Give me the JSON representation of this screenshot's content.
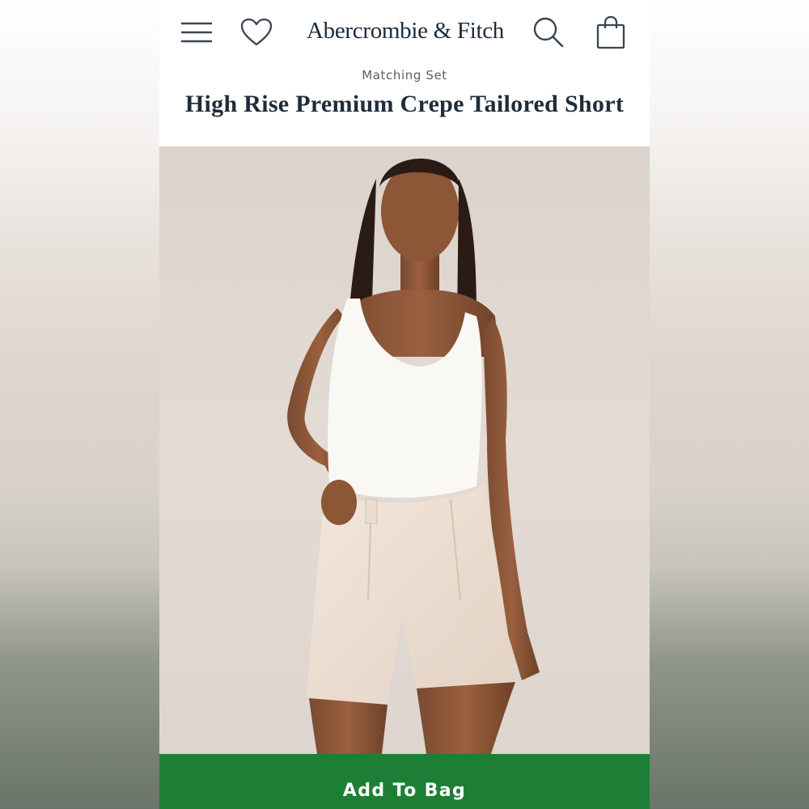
{
  "header": {
    "brand": "Abercrombie & Fitch",
    "icons": {
      "menu": "hamburger-menu-icon",
      "wishlist": "heart-icon",
      "search": "search-icon",
      "bag": "shopping-bag-icon"
    }
  },
  "product": {
    "eyebrow": "Matching Set",
    "title": "High Rise Premium Crepe Tailored Short",
    "image_description": "model in white tank top and cream pleated shorts"
  },
  "actions": {
    "add_to_bag": "Add To Bag"
  },
  "colors": {
    "brand_navy": "#1a2b3c",
    "cta_green": "#1d7f36",
    "photo_background": "#dfd7d0"
  }
}
